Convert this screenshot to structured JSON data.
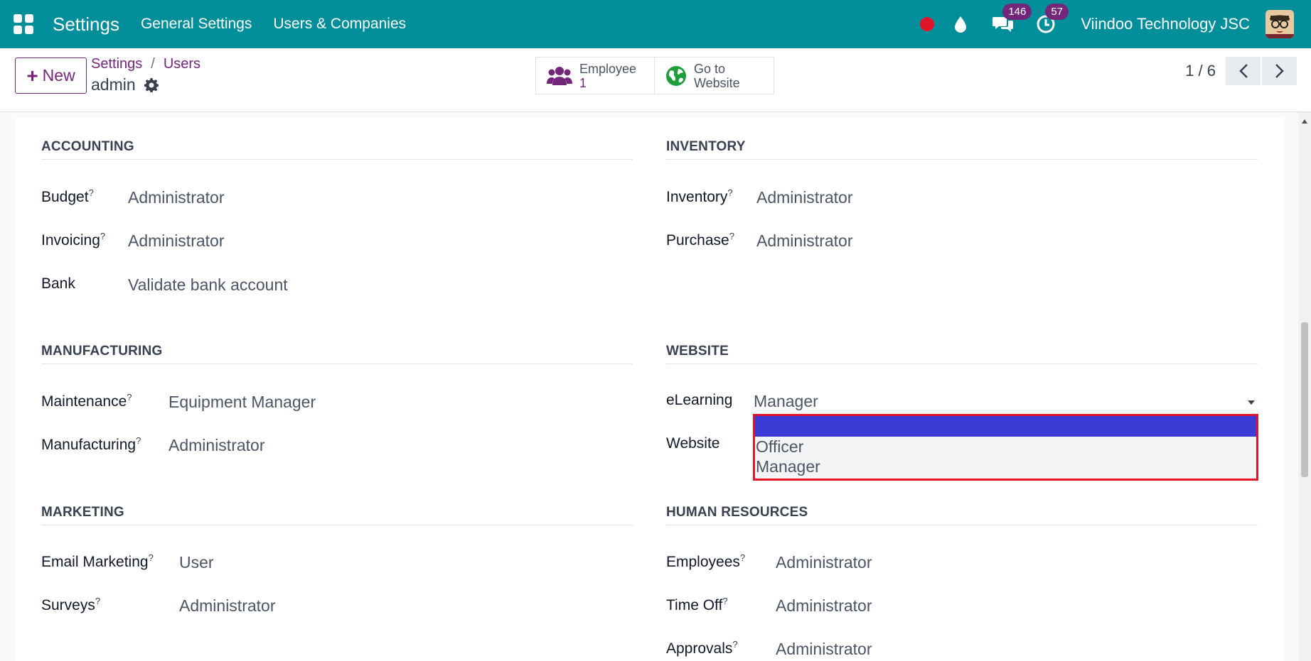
{
  "navbar": {
    "app_title": "Settings",
    "menu": [
      "General Settings",
      "Users & Companies"
    ],
    "messages_count": "146",
    "activities_count": "57",
    "company": "Viindoo Technology JSC",
    "colors": {
      "bar": "#008f9a",
      "badge": "#73277b",
      "record": "#e0142b"
    }
  },
  "control": {
    "new_label": "New",
    "breadcrumb": [
      "Settings",
      "Users"
    ],
    "breadcrumb_sep": "/",
    "record_name": "admin",
    "smart_buttons": {
      "employee": {
        "label": "Employee",
        "value": "1"
      },
      "website": {
        "label_line1": "Go to",
        "label_line2": "Website"
      }
    },
    "pager": "1 / 6"
  },
  "sections": {
    "accounting": {
      "title": "ACCOUNTING",
      "fields": [
        {
          "label": "Budget",
          "help": "?",
          "value": "Administrator"
        },
        {
          "label": "Invoicing",
          "help": "?",
          "value": "Administrator"
        },
        {
          "label": "Bank",
          "help": "",
          "value": "Validate bank account"
        }
      ]
    },
    "inventory": {
      "title": "INVENTORY",
      "fields": [
        {
          "label": "Inventory",
          "help": "?",
          "value": "Administrator"
        },
        {
          "label": "Purchase",
          "help": "?",
          "value": "Administrator"
        }
      ]
    },
    "manufacturing": {
      "title": "MANUFACTURING",
      "fields": [
        {
          "label": "Maintenance",
          "help": "?",
          "value": "Equipment Manager"
        },
        {
          "label": "Manufacturing",
          "help": "?",
          "value": "Administrator"
        }
      ]
    },
    "website": {
      "title": "WEBSITE",
      "fields": [
        {
          "label": "eLearning",
          "help": "",
          "value": "Manager"
        },
        {
          "label": "Website",
          "help": "",
          "value": ""
        }
      ],
      "dropdown_options": [
        "",
        "Officer",
        "Manager"
      ]
    },
    "marketing": {
      "title": "MARKETING",
      "fields": [
        {
          "label": "Email Marketing",
          "help": "?",
          "value": "User"
        },
        {
          "label": "Surveys",
          "help": "?",
          "value": "Administrator"
        }
      ]
    },
    "human_resources": {
      "title": "HUMAN RESOURCES",
      "fields": [
        {
          "label": "Employees",
          "help": "?",
          "value": "Administrator"
        },
        {
          "label": "Time Off",
          "help": "?",
          "value": "Administrator"
        },
        {
          "label": "Approvals",
          "help": "?",
          "value": "Administrator"
        }
      ]
    }
  }
}
